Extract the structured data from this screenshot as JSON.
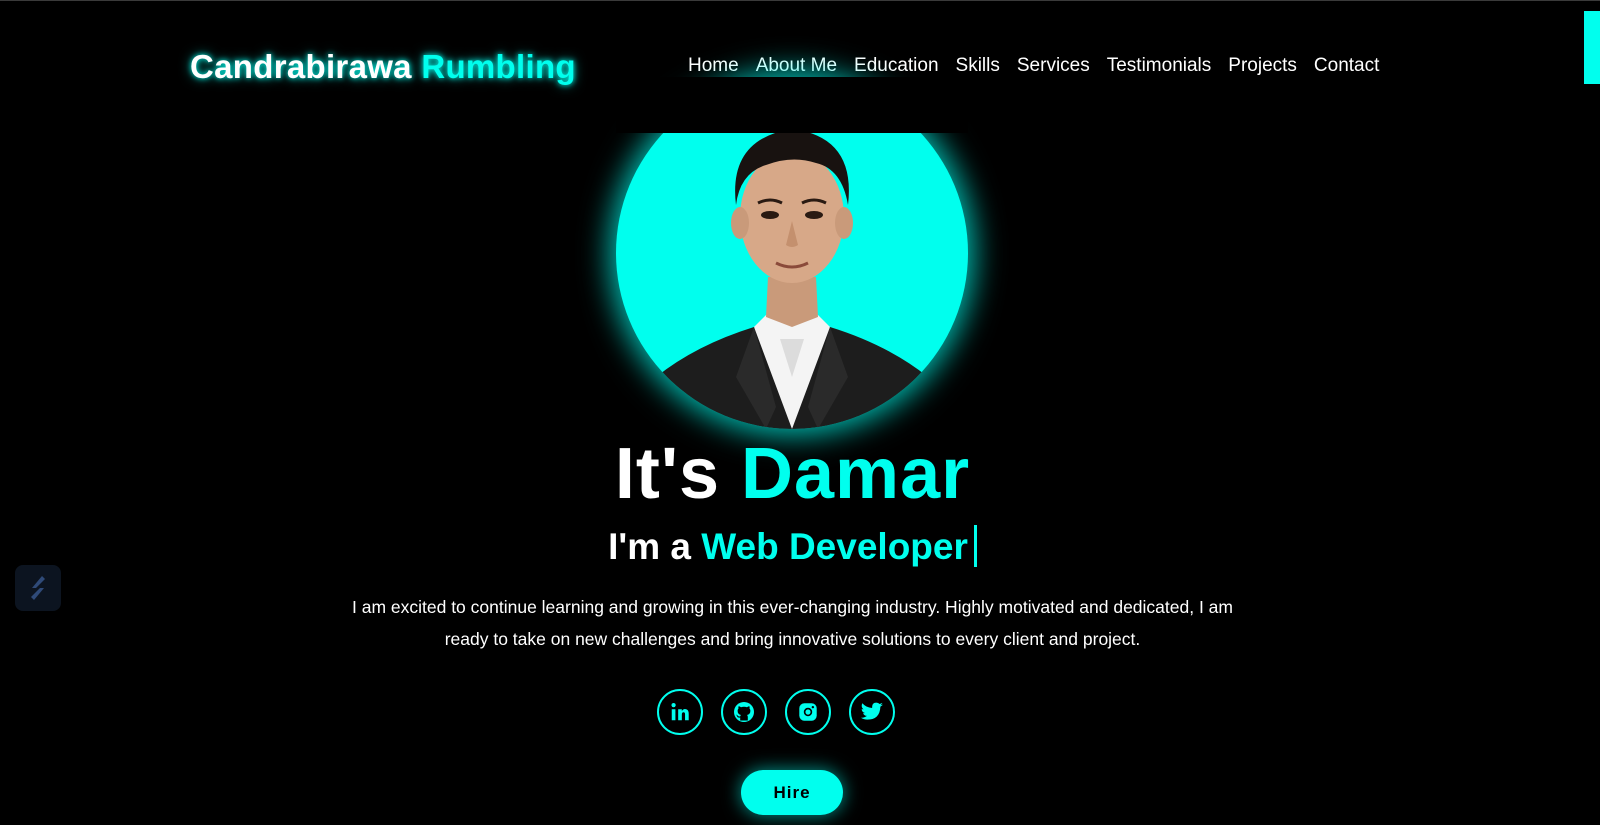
{
  "header": {
    "logo_first": "Candrabirawa",
    "logo_second": "Rumbling",
    "nav": [
      "Home",
      "About Me",
      "Education",
      "Skills",
      "Services",
      "Testimonials",
      "Projects",
      "Contact"
    ]
  },
  "hero": {
    "title_prefix": "It's",
    "title_name": "Damar",
    "subtitle_prefix": "I'm a",
    "subtitle_role": "Web Developer",
    "description": "I am excited to continue learning and growing in this ever-changing industry. Highly motivated and dedicated, I am ready to take on new challenges and bring innovative solutions to every client and project.",
    "hire_label": "Hire"
  },
  "socials": [
    {
      "icon": "linkedin-icon"
    },
    {
      "icon": "github-icon"
    },
    {
      "icon": "instagram-icon"
    },
    {
      "icon": "twitter-icon"
    }
  ],
  "colors": {
    "accent": "#00ffee",
    "background": "#000000",
    "text": "#ffffff"
  }
}
